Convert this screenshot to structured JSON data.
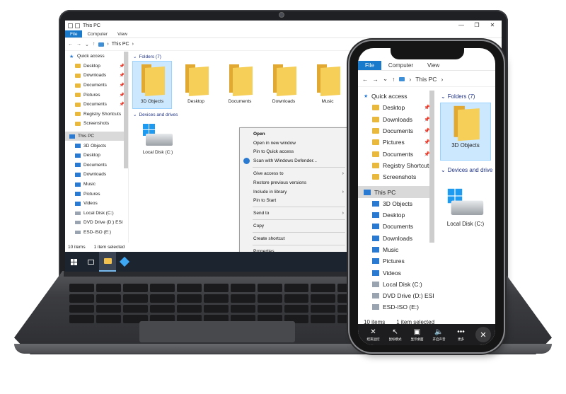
{
  "laptop": {
    "explorer": {
      "title": "This PC",
      "ribbon": {
        "file": "File",
        "computer": "Computer",
        "view": "View"
      },
      "address": "This PC",
      "window_controls": [
        "—",
        "❐",
        "✕"
      ],
      "nav": {
        "quick_access": "Quick access",
        "items": [
          {
            "label": "Desktop",
            "pinned": true
          },
          {
            "label": "Downloads",
            "pinned": true
          },
          {
            "label": "Documents",
            "pinned": true
          },
          {
            "label": "Pictures",
            "pinned": true
          },
          {
            "label": "Documents",
            "pinned": true
          },
          {
            "label": "Registry Shortcuts",
            "pinned": false
          },
          {
            "label": "Screenshots",
            "pinned": false
          }
        ],
        "this_pc": "This PC",
        "pc_items": [
          "3D Objects",
          "Desktop",
          "Documents",
          "Downloads",
          "Music",
          "Pictures",
          "Videos",
          "Local Disk (C:)",
          "DVD Drive (D:) ESI",
          "ESD-ISO (E:)"
        ]
      },
      "folders_header": "Folders (7)",
      "folders": [
        "3D Objects",
        "Desktop",
        "Documents",
        "Downloads",
        "Music"
      ],
      "devices_header": "Devices and drives",
      "drive": "Local Disk (C:)",
      "status": {
        "count": "10 items",
        "selected": "1 item selected"
      }
    },
    "context_menu": {
      "open": "Open",
      "open_new_window": "Open in new window",
      "pin_quick_access": "Pin to Quick access",
      "scan_defender": "Scan with Windows Defender...",
      "give_access": "Give access to",
      "restore_versions": "Restore previous versions",
      "include_library": "Include in library",
      "pin_start": "Pin to Start",
      "send_to": "Send to",
      "copy": "Copy",
      "create_shortcut": "Create shortcut",
      "properties": "Properties"
    }
  },
  "phone": {
    "ribbon": {
      "file": "File",
      "computer": "Computer",
      "view": "View"
    },
    "address": "This PC",
    "nav": {
      "quick_access": "Quick access",
      "items": [
        {
          "label": "Desktop",
          "pinned": true
        },
        {
          "label": "Downloads",
          "pinned": true
        },
        {
          "label": "Documents",
          "pinned": true
        },
        {
          "label": "Pictures",
          "pinned": true
        },
        {
          "label": "Documents",
          "pinned": true
        },
        {
          "label": "Registry Shortcuts",
          "pinned": false
        },
        {
          "label": "Screenshots",
          "pinned": false
        }
      ],
      "this_pc": "This PC",
      "pc_items": [
        "3D Objects",
        "Desktop",
        "Documents",
        "Downloads",
        "Music",
        "Pictures",
        "Videos",
        "Local Disk (C:)",
        "DVD Drive (D:) ESI",
        "ESD-ISO (E:)"
      ]
    },
    "folders_header": "Folders (7)",
    "selected_folder": "3D Objects",
    "devices_header": "Devices and drive",
    "drive": "Local Disk (C:)",
    "status": {
      "count": "10 items",
      "selected": "1 item selected"
    },
    "toolbar": [
      {
        "icon": "close-icon",
        "glyph": "✕",
        "label": "结束远控"
      },
      {
        "icon": "cursor-icon",
        "glyph": "↖",
        "label": "鼠标模式"
      },
      {
        "icon": "desktop-icon",
        "glyph": "▣",
        "label": "显示桌面"
      },
      {
        "icon": "speaker-icon",
        "glyph": "🔈",
        "label": "开启声音"
      },
      {
        "icon": "more-icon",
        "glyph": "•••",
        "label": "更多"
      }
    ],
    "close_glyph": "✕"
  }
}
